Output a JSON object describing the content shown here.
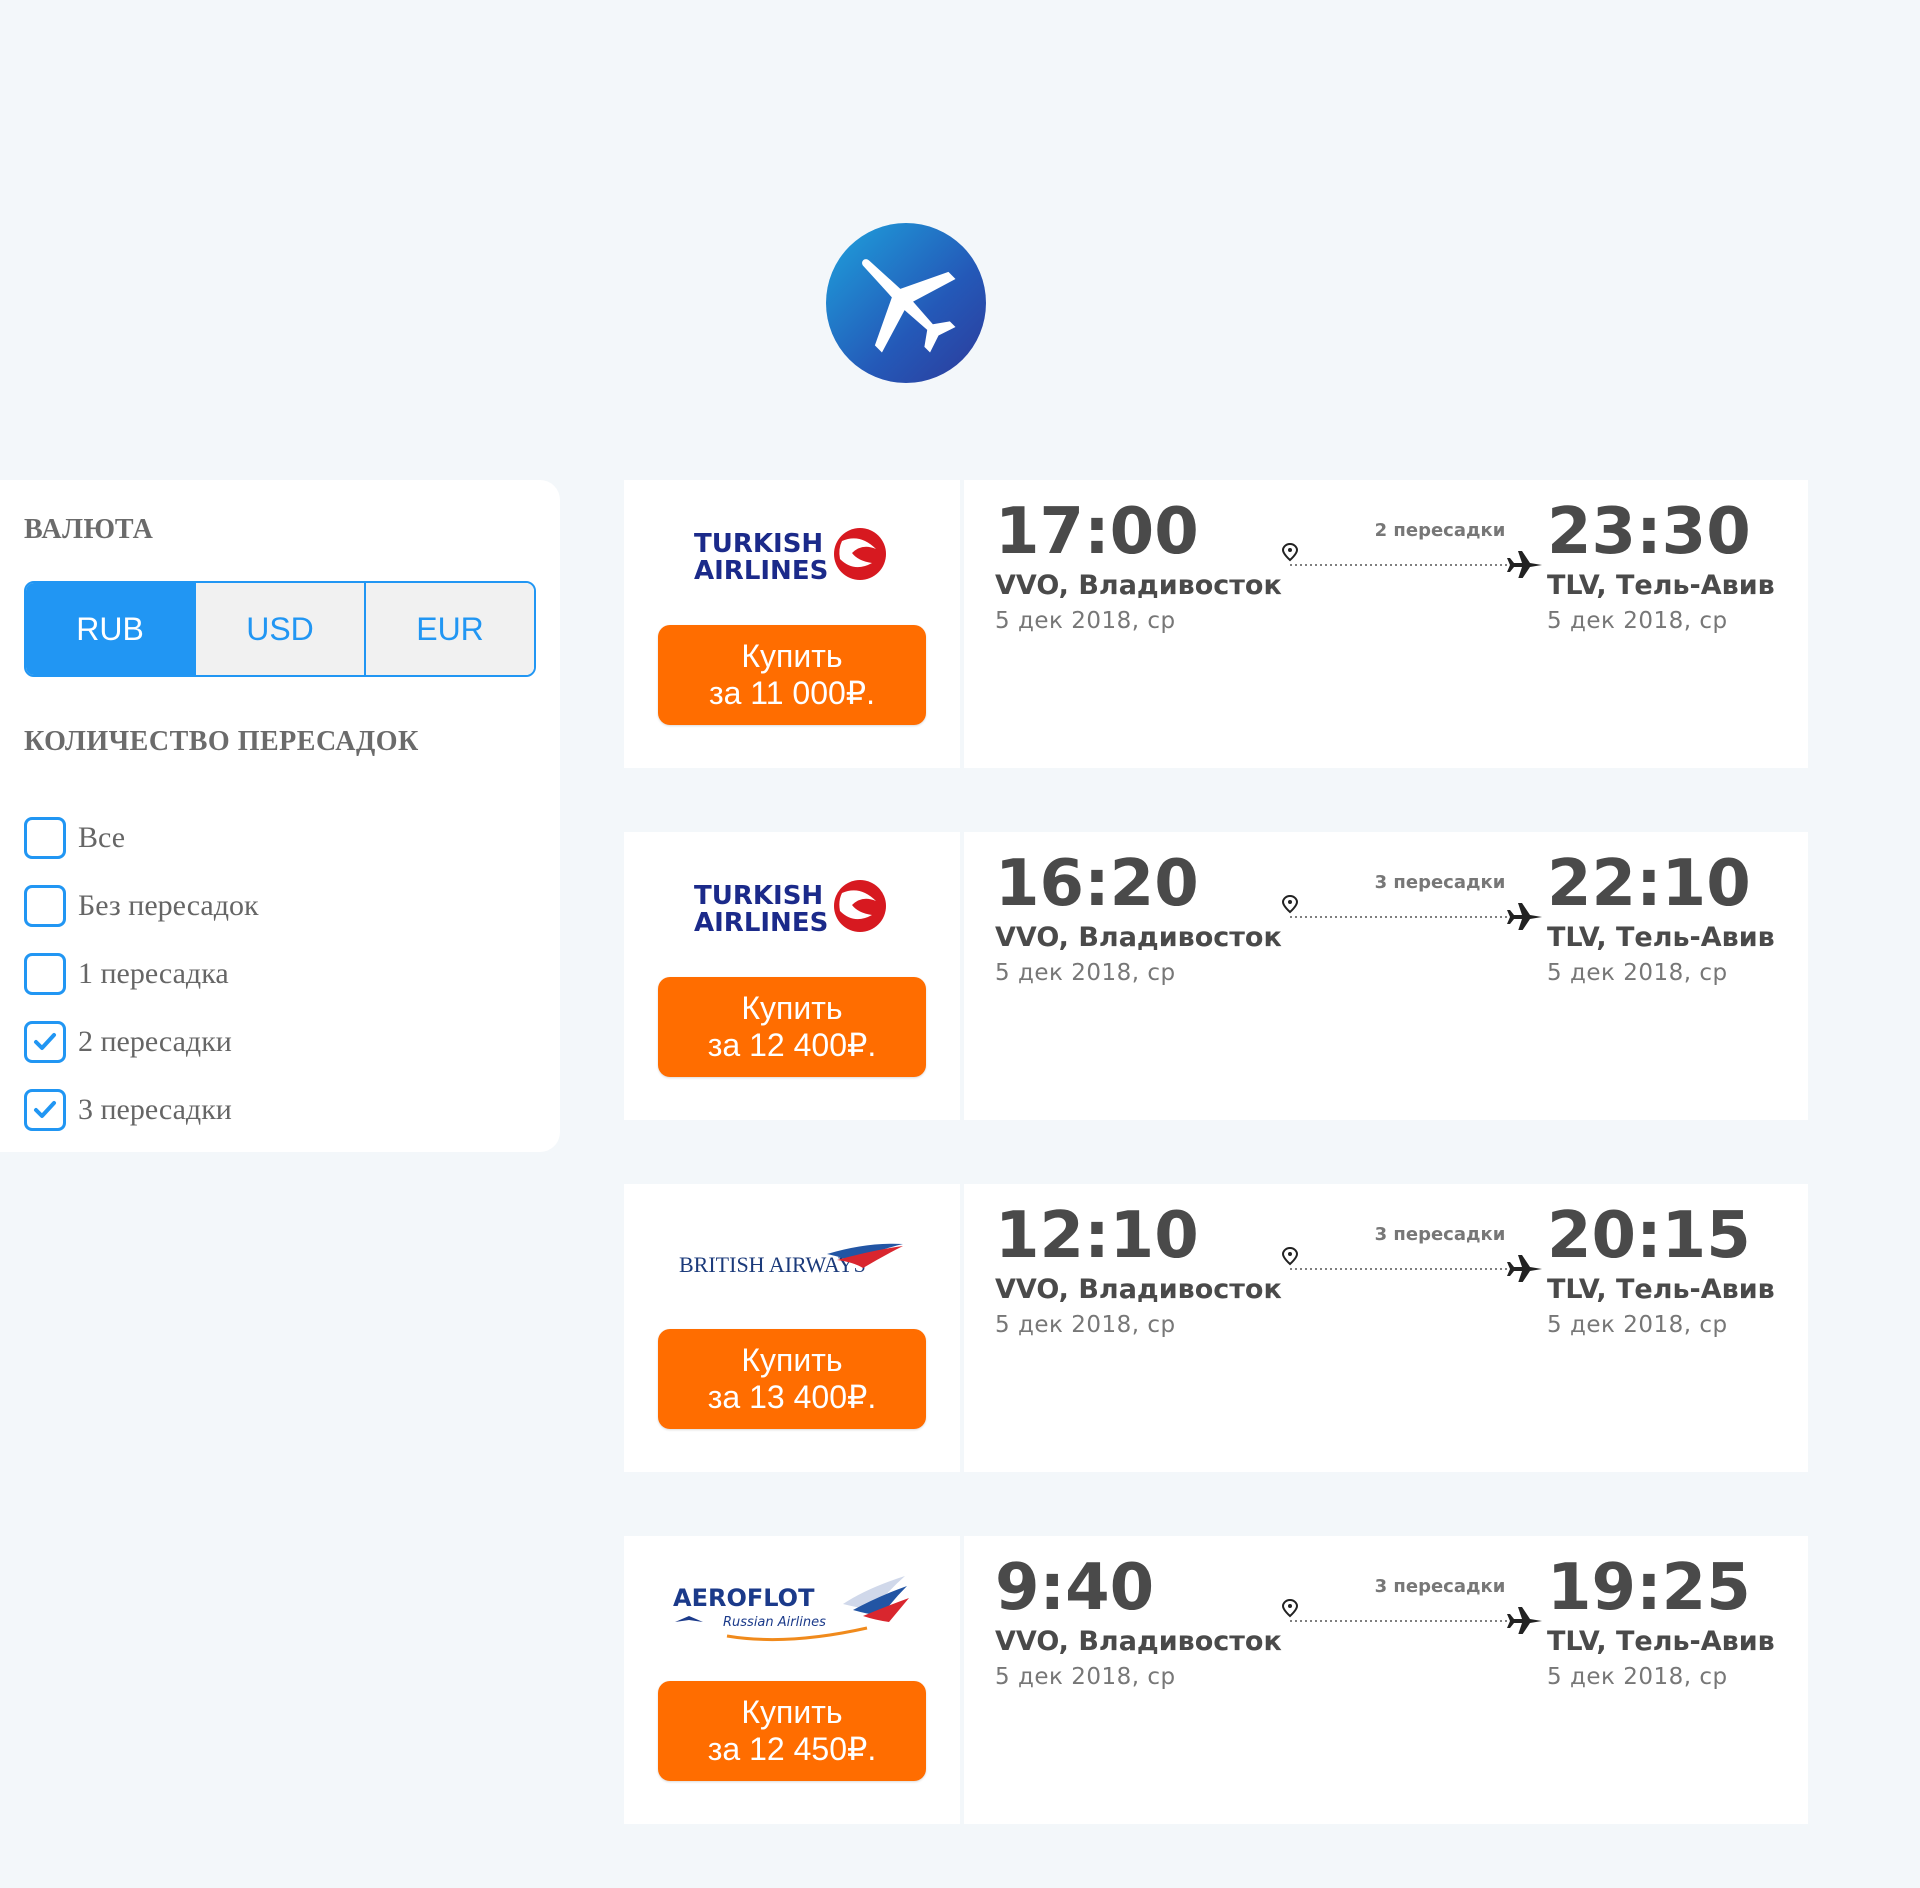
{
  "filters": {
    "currency_title": "ВАЛЮТА",
    "currencies": [
      {
        "label": "RUB",
        "active": true
      },
      {
        "label": "USD",
        "active": false
      },
      {
        "label": "EUR",
        "active": false
      }
    ],
    "stops_title": "КОЛИЧЕСТВО ПЕРЕСАДОК",
    "stops": [
      {
        "label": "Все",
        "checked": false
      },
      {
        "label": "Без пересадок",
        "checked": false
      },
      {
        "label": "1 пересадка",
        "checked": false
      },
      {
        "label": "2 пересадки",
        "checked": true
      },
      {
        "label": "3 пересадки",
        "checked": true
      }
    ]
  },
  "colors": {
    "accent": "#2196f3",
    "buy": "#ff6d00",
    "background": "#f3f7fa"
  },
  "tickets": [
    {
      "airline": "Turkish Airlines",
      "logo_line1": "TURKISH",
      "logo_line2": "AIRLINES",
      "buy_line1": "Купить",
      "buy_line2": "за 11 000₽.",
      "departure_time": "17:00",
      "departure_city": "VVO, Владивосток",
      "departure_date": "5 дек 2018, ср",
      "stops": "2 пересадки",
      "arrival_time": "23:30",
      "arrival_city": "TLV, Тель-Авив",
      "arrival_date": "5 дек 2018, ср"
    },
    {
      "airline": "Turkish Airlines",
      "logo_line1": "TURKISH",
      "logo_line2": "AIRLINES",
      "buy_line1": "Купить",
      "buy_line2": "за 12 400₽.",
      "departure_time": "16:20",
      "departure_city": "VVO, Владивосток",
      "departure_date": "5 дек 2018, ср",
      "stops": "3 пересадки",
      "arrival_time": "22:10",
      "arrival_city": "TLV, Тель-Авив",
      "arrival_date": "5 дек 2018, ср"
    },
    {
      "airline": "British Airways",
      "logo_line1": "BRITISH AIRWAYS",
      "buy_line1": "Купить",
      "buy_line2": "за 13 400₽.",
      "departure_time": "12:10",
      "departure_city": "VVO, Владивосток",
      "departure_date": "5 дек 2018, ср",
      "stops": "3 пересадки",
      "arrival_time": "20:15",
      "arrival_city": "TLV, Тель-Авив",
      "arrival_date": "5 дек 2018, ср"
    },
    {
      "airline": "Aeroflot",
      "logo_line1": "AEROFLOT",
      "logo_line2": "Russian Airlines",
      "buy_line1": "Купить",
      "buy_line2": "за 12 450₽.",
      "departure_time": "9:40",
      "departure_city": "VVO, Владивосток",
      "departure_date": "5 дек 2018, ср",
      "stops": "3 пересадки",
      "arrival_time": "19:25",
      "arrival_city": "TLV, Тель-Авив",
      "arrival_date": "5 дек 2018, ср"
    }
  ]
}
